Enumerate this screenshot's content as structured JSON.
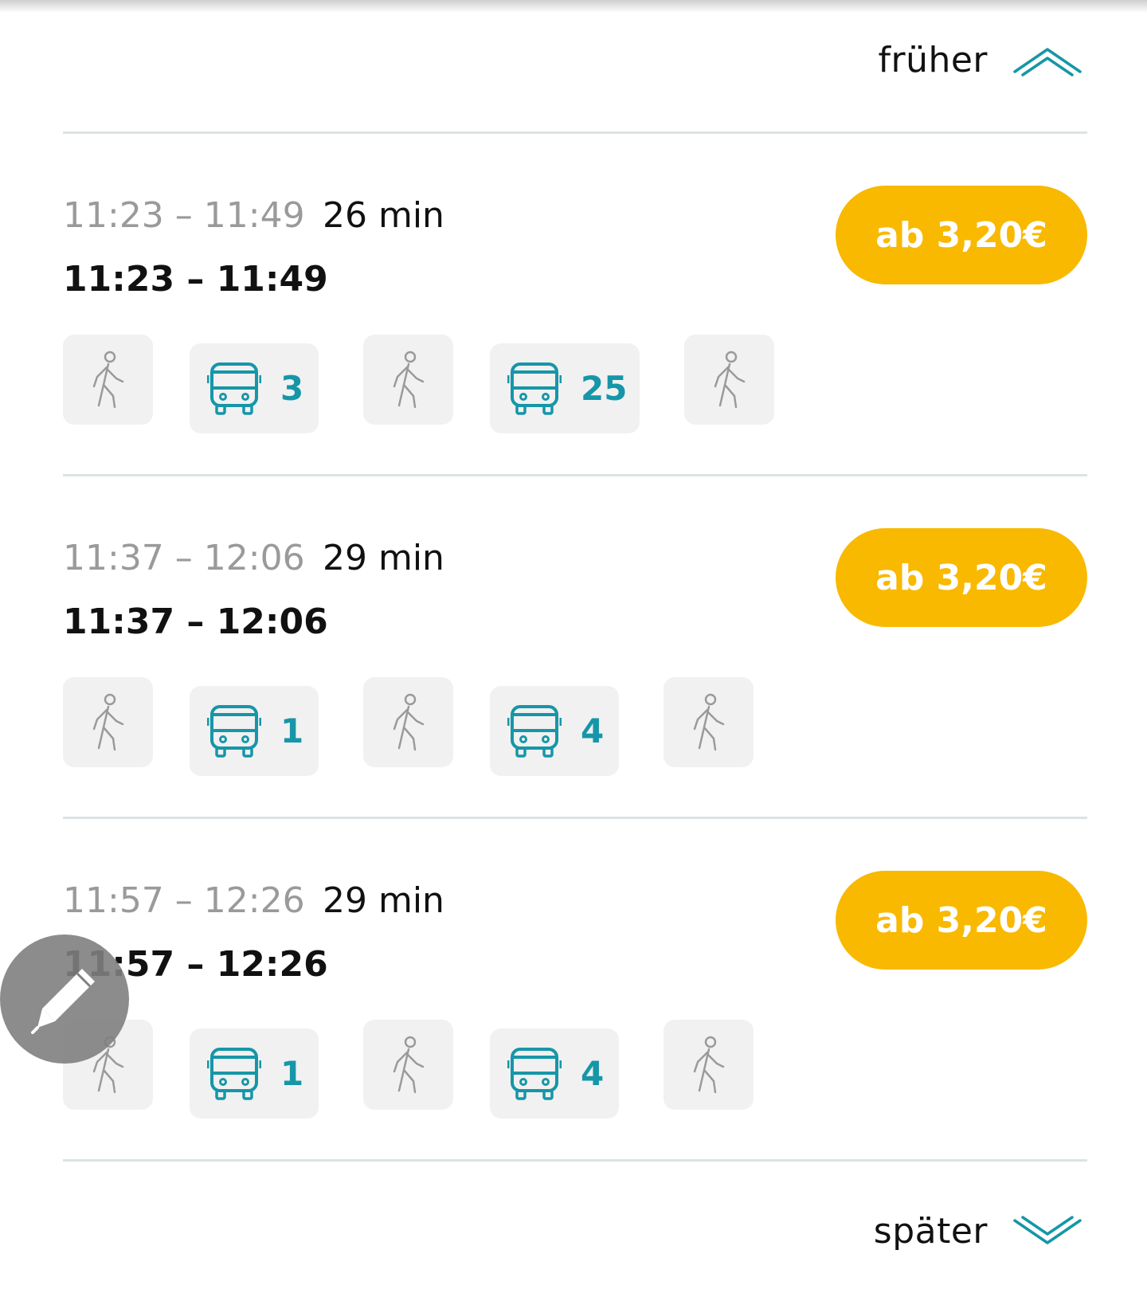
{
  "navigation": {
    "earlier_label": "früher",
    "earlier_icon": "chevron-double-up-icon",
    "later_label": "später",
    "later_icon": "chevron-double-down-icon"
  },
  "colors": {
    "accent_teal": "#1696a8",
    "price_button": "#f8b900",
    "leg_background": "#f1f1f1",
    "divider": "#dde3e5",
    "muted_text": "#9a9a9a"
  },
  "trips": [
    {
      "planned_time": "11:23 – 11:49",
      "duration": "26 min",
      "actual_time": "11:23 – 11:49",
      "price_label": "ab 3,20€",
      "legs": [
        {
          "type": "walk",
          "icon": "walk-icon"
        },
        {
          "type": "bus",
          "icon": "bus-icon",
          "line": "3"
        },
        {
          "type": "walk",
          "icon": "walk-icon"
        },
        {
          "type": "bus",
          "icon": "bus-icon",
          "line": "25"
        },
        {
          "type": "walk",
          "icon": "walk-icon"
        }
      ]
    },
    {
      "planned_time": "11:37 – 12:06",
      "duration": "29 min",
      "actual_time": "11:37 – 12:06",
      "price_label": "ab 3,20€",
      "legs": [
        {
          "type": "walk",
          "icon": "walk-icon"
        },
        {
          "type": "bus",
          "icon": "bus-icon",
          "line": "1"
        },
        {
          "type": "walk",
          "icon": "walk-icon"
        },
        {
          "type": "bus",
          "icon": "bus-icon",
          "line": "4"
        },
        {
          "type": "walk",
          "icon": "walk-icon"
        }
      ]
    },
    {
      "planned_time": "11:57 – 12:26",
      "duration": "29 min",
      "actual_time": "11:57 – 12:26",
      "price_label": "ab 3,20€",
      "legs": [
        {
          "type": "walk",
          "icon": "walk-icon"
        },
        {
          "type": "bus",
          "icon": "bus-icon",
          "line": "1"
        },
        {
          "type": "walk",
          "icon": "walk-icon"
        },
        {
          "type": "bus",
          "icon": "bus-icon",
          "line": "4"
        },
        {
          "type": "walk",
          "icon": "walk-icon"
        }
      ]
    }
  ],
  "fab": {
    "icon": "pencil-icon"
  }
}
